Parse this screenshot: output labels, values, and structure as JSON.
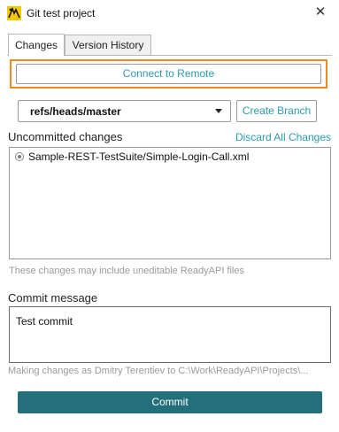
{
  "window": {
    "title": "Git test project",
    "close_glyph": "✕",
    "app_icon": "readyapi-git-icon"
  },
  "tabs": [
    {
      "label": "Changes",
      "active": true
    },
    {
      "label": "Version History",
      "active": false
    }
  ],
  "connect_button": {
    "label": "Connect to Remote",
    "highlight_color": "#f08a1c"
  },
  "branch": {
    "selected": "refs/heads/master"
  },
  "create_branch_button": {
    "label": "Create Branch"
  },
  "uncommitted": {
    "label": "Uncommitted changes",
    "discard_link": "Discard All Changes",
    "items": [
      {
        "text": "Sample-REST-TestSuite/Simple-Login-Call.xml"
      }
    ],
    "hint": "These changes may include uneditable ReadyAPI files"
  },
  "commit": {
    "label": "Commit message",
    "message": "Test commit",
    "author_note": "Making changes as Dmitry Terentiev to C:\\Work\\ReadyAPI\\Projects\\...",
    "button_label": "Commit"
  },
  "colors": {
    "accent": "#2a9bb0",
    "primary_button": "#236f7b",
    "highlight": "#f08a1c",
    "muted_text": "#9a9a9a"
  }
}
